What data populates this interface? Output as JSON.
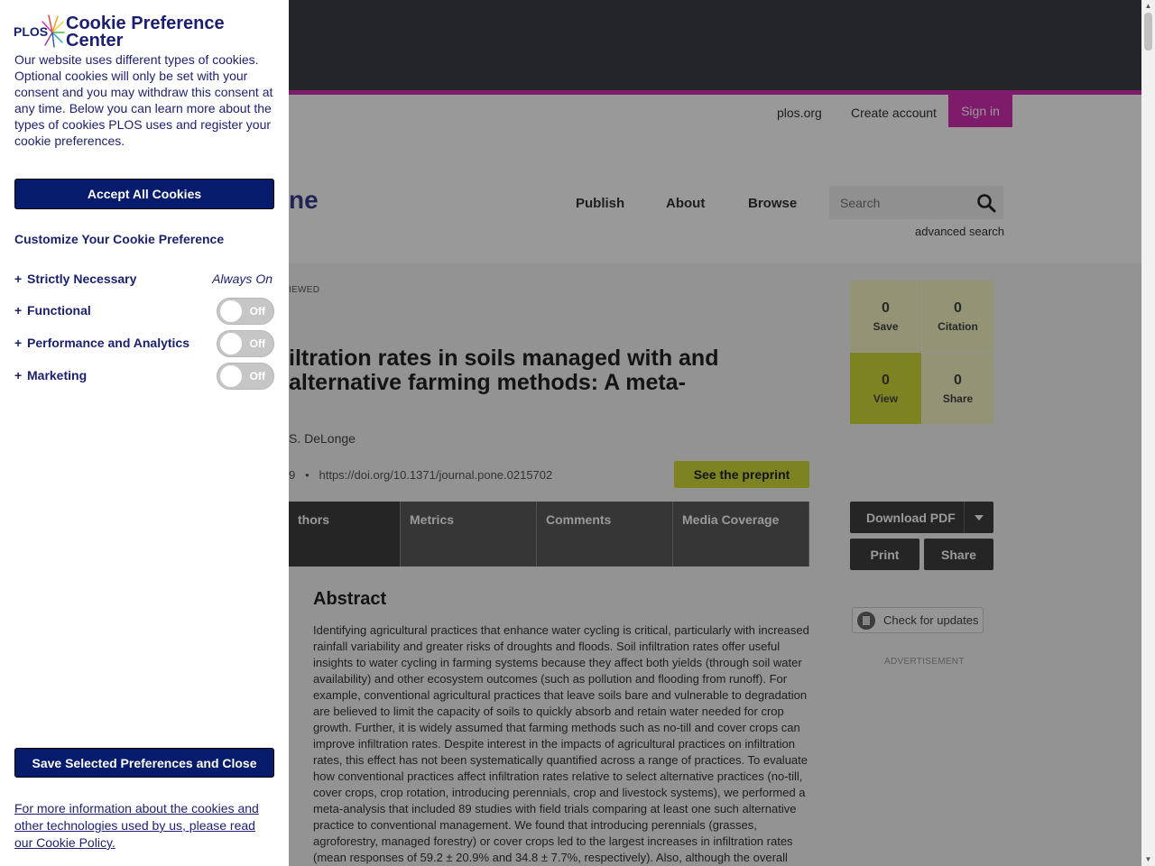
{
  "header": {
    "util_links": [
      "plos.org",
      "Create account"
    ],
    "signin_label": "Sign in",
    "logo_fragment": "ne",
    "nav": [
      "Publish",
      "About",
      "Browse"
    ],
    "search_placeholder": "Search",
    "advanced_search": "advanced search"
  },
  "article": {
    "review_badge": "IEWED",
    "title": "iltration rates in soils managed with and alternative farming methods: A meta-",
    "authors": "S. DeLonge",
    "doi_prefix": "9",
    "doi_url": "https://doi.org/10.1371/journal.pone.0215702",
    "preprint_label": "See the preprint",
    "tabs": [
      "thors",
      "Metrics",
      "Comments",
      "Media Coverage"
    ],
    "abstract_heading": "Abstract",
    "abstract_text": "Identifying agricultural practices that enhance water cycling is critical, particularly with increased rainfall variability and greater risks of droughts and floods. Soil infiltration rates offer useful insights to water cycling in farming systems because they affect both yields (through soil water availability) and other ecosystem outcomes (such as pollution and flooding from runoff). For example, conventional agricultural practices that leave soils bare and vulnerable to degradation are believed to limit the capacity of soils to quickly absorb and retain water needed for crop growth. Further, it is widely assumed that farming methods such as no-till and cover crops can improve infiltration rates. Despite interest in the impacts of agricultural practices on infiltration rates, this effect has not been systematically quantified across a range of practices. To evaluate how conventional practices affect infiltration rates relative to select alternative practices (no-till, cover crops, crop rotation, introducing perennials, crop and livestock systems), we performed a meta-analysis that included 89 studies with field trials comparing at least one such alternative practice to conventional management. We found that introducing perennials (grasses, agroforestry, managed forestry) or cover crops led to the largest increases in infiltration rates (mean responses of 59.2 ± 20.9% and 34.8 ± 7.7%, respectively). Also, although the overall"
  },
  "sidebar": {
    "metrics": [
      {
        "value": "0",
        "label": "Save"
      },
      {
        "value": "0",
        "label": "Citation"
      },
      {
        "value": "0",
        "label": "View"
      },
      {
        "value": "0",
        "label": "Share"
      }
    ],
    "download_label": "Download PDF",
    "print_label": "Print",
    "share_label": "Share",
    "updates_label": "Check for updates",
    "advert_label": "ADVERTISEMENT"
  },
  "cookie": {
    "logo_text": "PLOS",
    "title": "Cookie Preference Center",
    "description": "Our website uses different types of cookies. Optional cookies will only be set with your consent and you may withdraw this consent at any time. Below you can learn more about the types of cookies PLOS uses and register your cookie preferences.",
    "accept_label": "Accept All Cookies",
    "subhead": "Customize Your Cookie Preference",
    "categories": [
      {
        "plus": "+",
        "name": "Strictly Necessary",
        "state": "Always On"
      },
      {
        "plus": "+",
        "name": "Functional",
        "state": "Off"
      },
      {
        "plus": "+",
        "name": "Performance and Analytics",
        "state": "Off"
      },
      {
        "plus": "+",
        "name": "Marketing",
        "state": "Off"
      }
    ],
    "save_label": "Save Selected Preferences and Close",
    "footer_text": "For more information about the cookies and other technologies used by us, please read our Cookie Policy."
  },
  "colors": {
    "brand_magenta": "#d42eb2",
    "cookie_navy": "#061b6b",
    "metric_highlight": "#d3db39"
  }
}
